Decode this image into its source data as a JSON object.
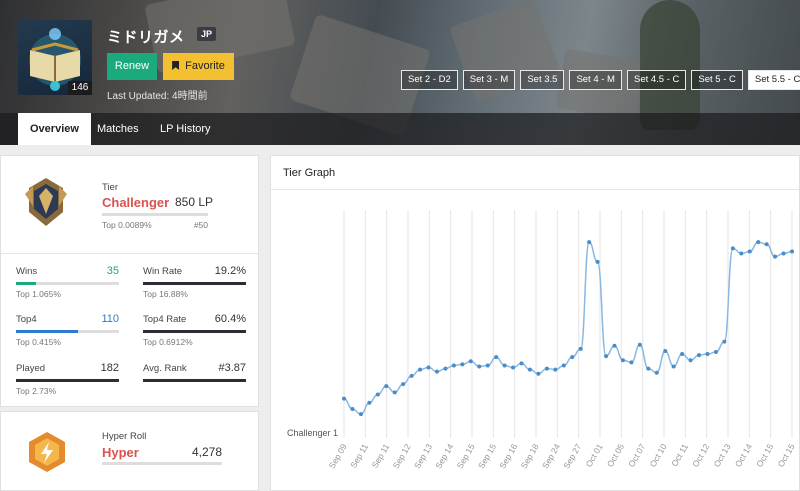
{
  "profile": {
    "name": "ミドリガメ",
    "region": "JP",
    "level": "146",
    "renew_label": "Renew",
    "favorite_label": "Favorite",
    "last_updated": "Last Updated: 4時間前"
  },
  "sets": [
    "Set 2 - D2",
    "Set 3 - M",
    "Set 3.5",
    "Set 4 - M",
    "Set 4.5 - C",
    "Set 5 - C",
    "Set 5.5 - C"
  ],
  "active_set_index": 6,
  "tabs": [
    {
      "label": "Overview",
      "active": true
    },
    {
      "label": "Matches",
      "active": false
    },
    {
      "label": "LP History",
      "active": false
    }
  ],
  "tier_card": {
    "label": "Tier",
    "rank": "Challenger",
    "lp": "850 LP",
    "top": "Top 0.0089%",
    "position": "#50"
  },
  "stats": [
    {
      "label": "Wins",
      "value": "35",
      "sub": "Top 1.065%",
      "fill": 0.19,
      "color": "#1aaa7e"
    },
    {
      "label": "Win Rate",
      "value": "19.2%",
      "sub": "Top 16.88%",
      "fill": 1.0,
      "color": "#2c2c35"
    },
    {
      "label": "Top4",
      "value": "110",
      "sub": "Top 0.415%",
      "fill": 0.6,
      "color": "#2a7bd1"
    },
    {
      "label": "Top4 Rate",
      "value": "60.4%",
      "sub": "Top 0.6912%",
      "fill": 1.0,
      "color": "#2c2c35"
    },
    {
      "label": "Played",
      "value": "182",
      "sub": "Top 2.73%",
      "fill": 1.0,
      "color": "#2c2c35"
    },
    {
      "label": "Avg. Rank",
      "value": "#3.87",
      "sub": "",
      "fill": 1.0,
      "color": "#2c2c35"
    }
  ],
  "hyper_card": {
    "label": "Hyper Roll",
    "rank": "Hyper",
    "value": "4,278"
  },
  "colors": {
    "accent_green": "#1aaa7e",
    "accent_yellow": "#f2c031",
    "rank_red": "#d9534f",
    "line_blue": "#5b9bd5"
  },
  "graph": {
    "title": "Tier Graph",
    "y_label": "Challenger 1"
  },
  "chart_data": {
    "type": "line",
    "title": "Tier Graph",
    "ylabel": "Challenger 1",
    "x": [
      "Sep 09",
      "Sep 11",
      "Sep 11",
      "Sep 12",
      "Sep 13",
      "Sep 14",
      "Sep 15",
      "Sep 15",
      "Sep 16",
      "Sep 18",
      "Sep 24",
      "Sep 27",
      "Oct 01",
      "Oct 05",
      "Oct 07",
      "Oct 10",
      "Oct 11",
      "Oct 12",
      "Oct 13",
      "Oct 14",
      "Oct 15",
      "Oct 15"
    ],
    "values": [
      382,
      392,
      397,
      386,
      378,
      370,
      376,
      368,
      360,
      354,
      352,
      356,
      353,
      350,
      349,
      346,
      351,
      350,
      342,
      350,
      352,
      348,
      354,
      358,
      353,
      354,
      350,
      342,
      334,
      231,
      250,
      341,
      331,
      345,
      347,
      330,
      353,
      357,
      336,
      351,
      339,
      345,
      340,
      339,
      337,
      327,
      237,
      242,
      240,
      231,
      233,
      245,
      242,
      240
    ]
  }
}
